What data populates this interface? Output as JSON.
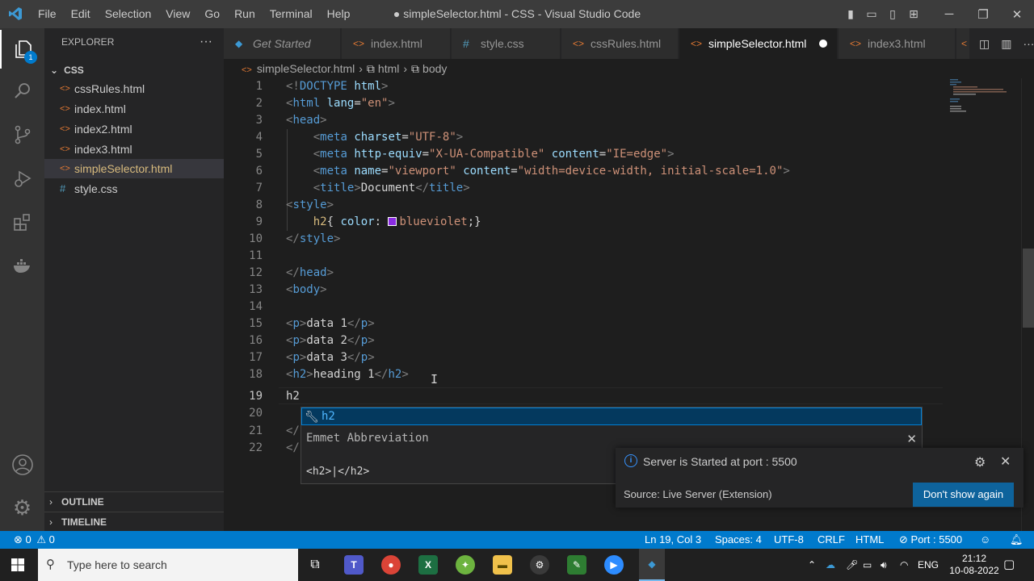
{
  "window": {
    "title": "● simpleSelector.html - CSS - Visual Studio Code",
    "menu": [
      "File",
      "Edit",
      "Selection",
      "View",
      "Go",
      "Run",
      "Terminal",
      "Help"
    ]
  },
  "activity": {
    "explorer_badge": "1"
  },
  "sidebar": {
    "header": "EXPLORER",
    "folder": "CSS",
    "files": [
      {
        "name": "cssRules.html",
        "icon": "html-icon"
      },
      {
        "name": "index.html",
        "icon": "html-icon"
      },
      {
        "name": "index2.html",
        "icon": "html-icon"
      },
      {
        "name": "index3.html",
        "icon": "html-icon"
      },
      {
        "name": "simpleSelector.html",
        "icon": "html-icon"
      },
      {
        "name": "style.css",
        "icon": "css-icon"
      }
    ],
    "outline": "OUTLINE",
    "timeline": "TIMELINE"
  },
  "tabs": [
    {
      "label": "Get Started"
    },
    {
      "label": "index.html"
    },
    {
      "label": "style.css"
    },
    {
      "label": "cssRules.html"
    },
    {
      "label": "simpleSelector.html"
    },
    {
      "label": "index3.html"
    }
  ],
  "breadcrumb": [
    "simpleSelector.html",
    "html",
    "body"
  ],
  "editor": {
    "line_numbers": [
      "1",
      "2",
      "3",
      "4",
      "5",
      "6",
      "7",
      "8",
      "9",
      "10",
      "11",
      "12",
      "13",
      "14",
      "15",
      "16",
      "17",
      "18",
      "19",
      "20",
      "21",
      "22"
    ],
    "typed_line": "h2"
  },
  "suggest": {
    "item": "h2",
    "detail": "Emmet Abbreviation",
    "preview": "<h2>|</h2>"
  },
  "notification": {
    "message": "Server is Started at port : 5500",
    "source": "Source: Live Server (Extension)",
    "button": "Don't show again"
  },
  "status": {
    "errors": "0",
    "warnings": "0",
    "position": "Ln 19, Col 3",
    "spaces": "Spaces: 4",
    "encoding": "UTF-8",
    "eol": "CRLF",
    "language": "HTML",
    "port": "Port : 5500"
  },
  "taskbar": {
    "search_placeholder": "Type here to search",
    "lang": "ENG",
    "time": "21:12",
    "date": "10-08-2022"
  },
  "colors": {
    "accent": "#007acc",
    "css_value_swatch": "#8a2be2"
  }
}
